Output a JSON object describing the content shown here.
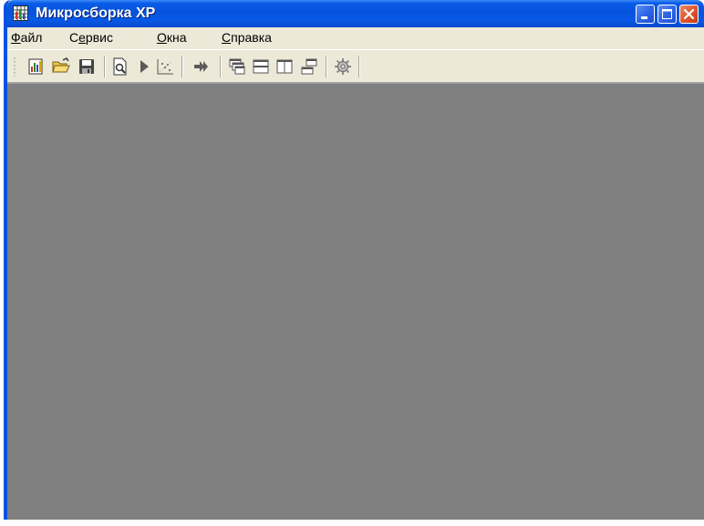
{
  "window": {
    "title": "Микросборка XP",
    "app_icon": "chart-grid-icon",
    "caption_buttons": [
      "minimize",
      "maximize",
      "close"
    ]
  },
  "menu": {
    "items": [
      {
        "mnemonic": "Ф",
        "rest": "айл"
      },
      {
        "prefix": "С",
        "mnemonic": "е",
        "rest": "рвис"
      },
      {
        "mnemonic": "О",
        "rest": "кна"
      },
      {
        "mnemonic": "С",
        "rest": "правка"
      }
    ]
  },
  "toolbar": {
    "buttons": [
      "new-document-icon",
      "open-folder-icon",
      "save-icon",
      "print-preview-icon",
      "play-icon",
      "scatter-chart-icon",
      "forward-arrow-icon",
      "cascade-windows-icon",
      "tile-horizontal-icon",
      "tile-vertical-icon",
      "arrange-icons-icon",
      "settings-gear-icon"
    ]
  },
  "colors": {
    "titlebar": "#0553dd",
    "menubar": "#ece9d8",
    "client_area": "#808080",
    "close_button": "#e1572e"
  }
}
